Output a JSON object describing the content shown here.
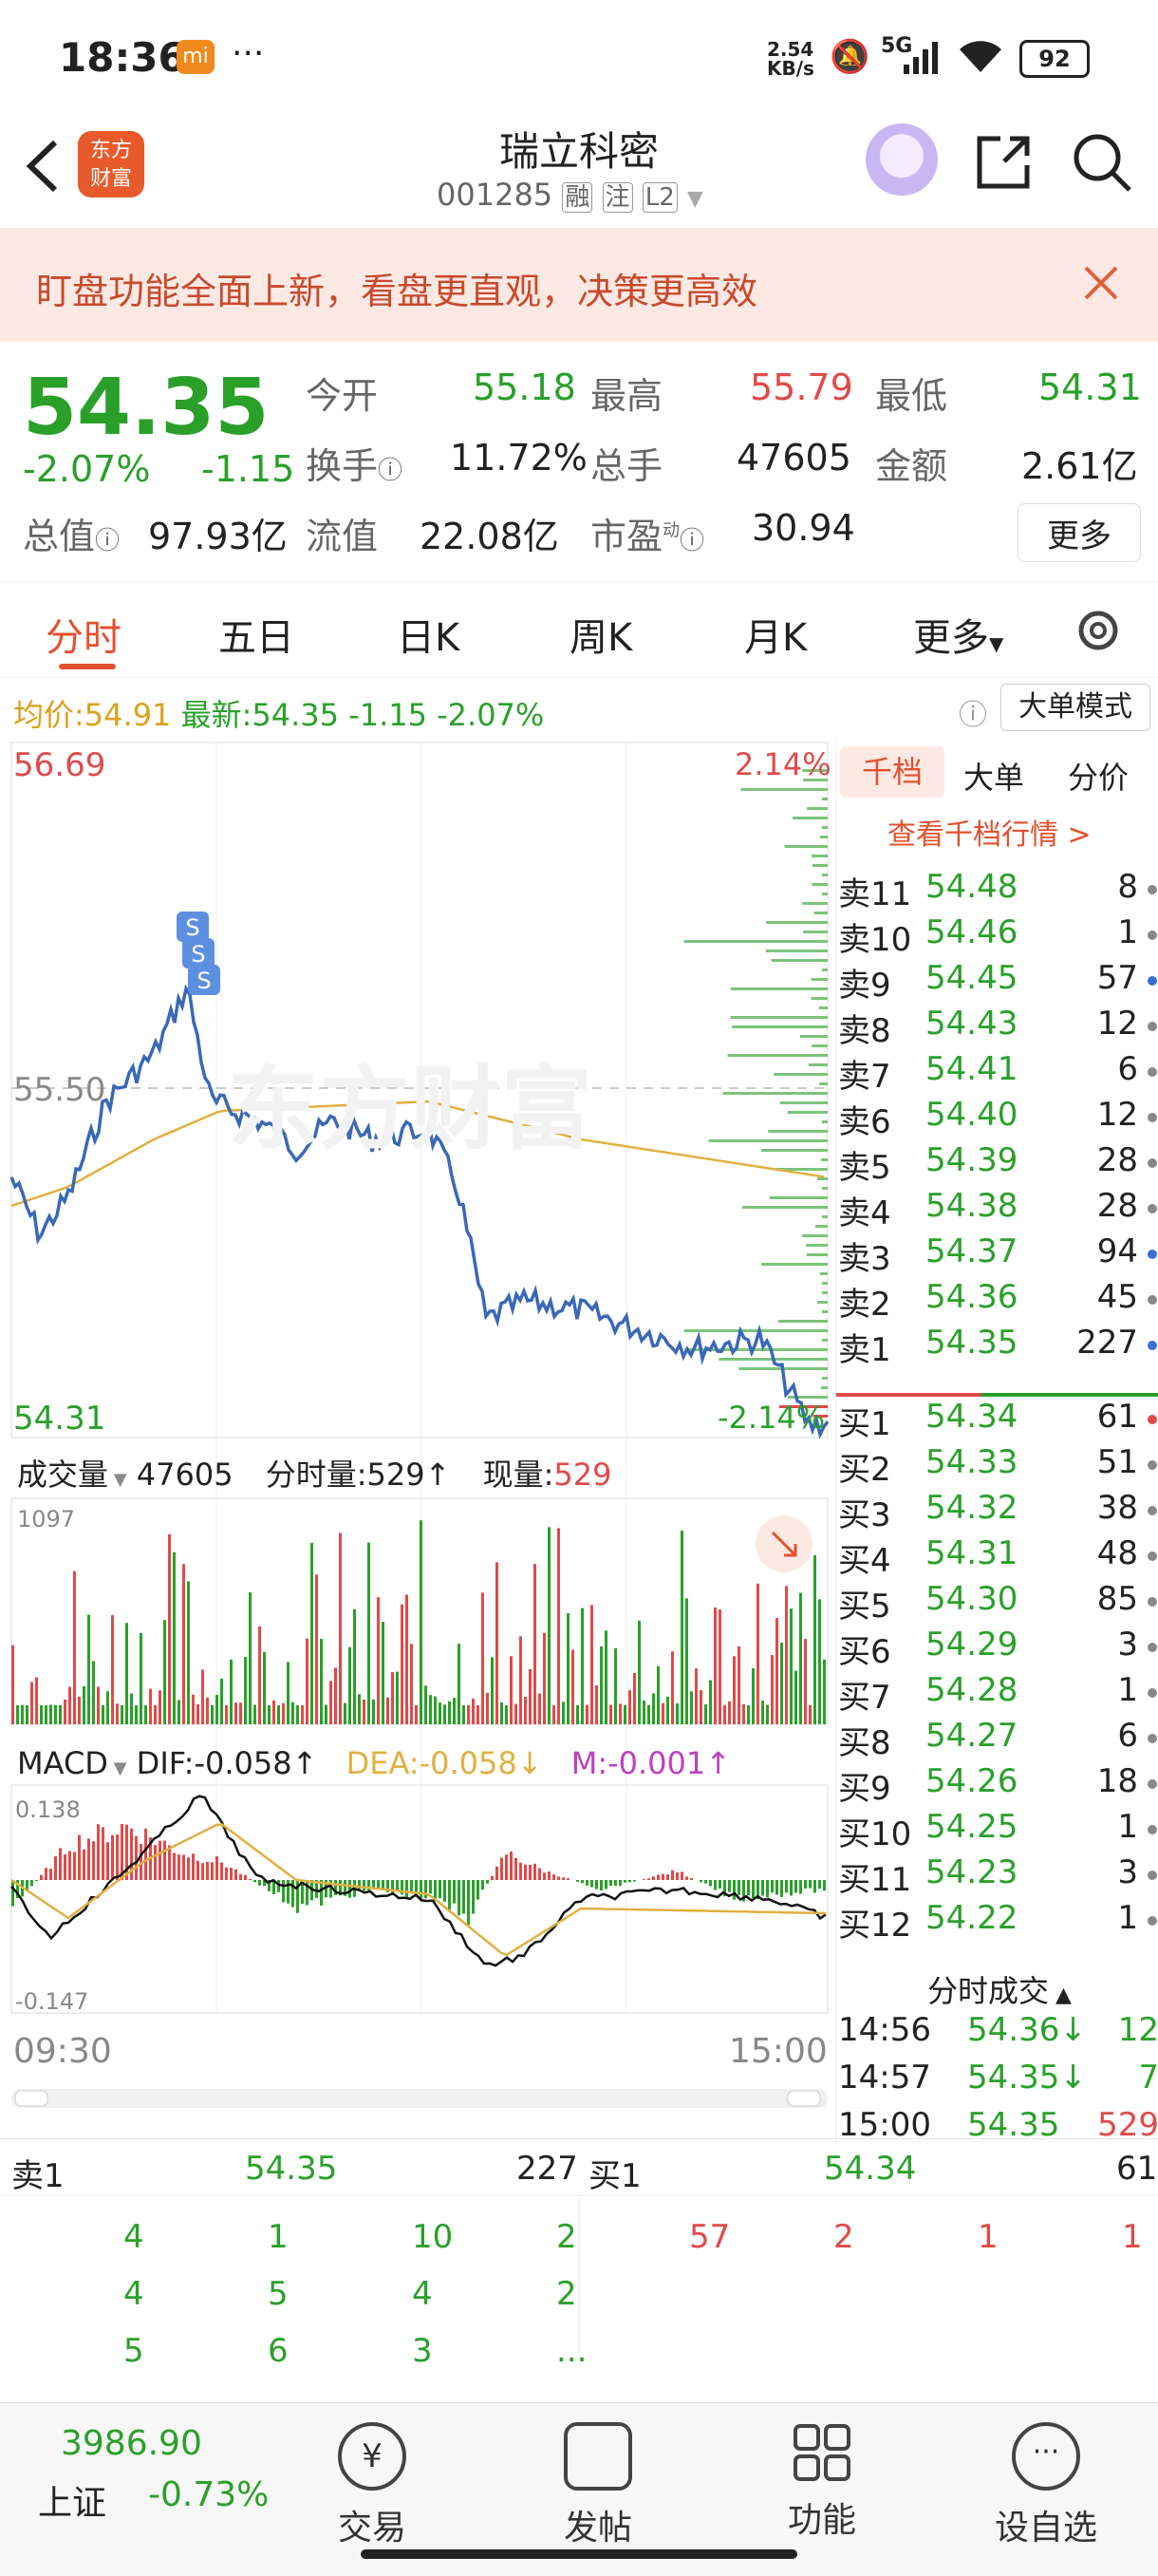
{
  "status": {
    "time": "18:36",
    "app_badge": "mi",
    "more": "···",
    "speed_top": "2.54",
    "speed_bottom": "KB/s",
    "network": "5G",
    "battery": "92"
  },
  "header": {
    "logo_top": "东方",
    "logo_bottom": "财富",
    "stock_name": "瑞立科密",
    "stock_code": "001285",
    "tags": [
      "融",
      "注",
      "L2"
    ]
  },
  "banner": {
    "text": "盯盘功能全面上新，看盘更直观，决策更高效"
  },
  "quote": {
    "price": "54.35",
    "change_pct": "-2.07%",
    "change": "-1.15",
    "open_label": "今开",
    "open": "55.18",
    "high_label": "最高",
    "high": "55.79",
    "low_label": "最低",
    "low": "54.31",
    "turnover_label": "换手",
    "turnover": "11.72%",
    "volume_label": "总手",
    "volume": "47605",
    "amount_label": "金额",
    "amount": "2.61亿",
    "mktcap_label": "总值",
    "mktcap": "97.93亿",
    "float_label": "流值",
    "float": "22.08亿",
    "pe_label": "市盈",
    "pe_sup": "动",
    "pe": "30.94",
    "more_btn": "更多"
  },
  "tabs": [
    "分时",
    "五日",
    "日K",
    "周K",
    "月K",
    "更多"
  ],
  "chart_info": {
    "avg_label": "均价:",
    "avg": "54.91",
    "last_label": "最新:",
    "last": "54.35",
    "chg": "-1.15",
    "chg_pct": "-2.07%",
    "big_order_mode": "大单模式",
    "price_top": "56.69",
    "price_mid": "55.50",
    "price_bottom": "54.31",
    "pct_top": "2.14%",
    "pct_bottom": "-2.14%",
    "watermark": "东方财富"
  },
  "volume_panel": {
    "label": "成交量",
    "total": "47605",
    "tick_label": "分时量:529",
    "now_label": "现量:",
    "now": "529",
    "max": "1097"
  },
  "macd_panel": {
    "label": "MACD",
    "dif": "DIF:-0.058",
    "dea": "DEA:-0.058",
    "m": "M:-0.001",
    "top": "0.138",
    "bottom": "-0.147"
  },
  "time_axis": {
    "start": "09:30",
    "end": "15:00"
  },
  "orderbook": {
    "tabs": [
      "千档",
      "大单",
      "分价"
    ],
    "link": "查看千档行情 >",
    "sells": [
      {
        "label": "卖11",
        "price": "54.48",
        "vol": "8",
        "dot": "#888888"
      },
      {
        "label": "卖10",
        "price": "54.46",
        "vol": "1",
        "dot": "#888888"
      },
      {
        "label": "卖9",
        "price": "54.45",
        "vol": "57",
        "dot": "#3a6fd8"
      },
      {
        "label": "卖8",
        "price": "54.43",
        "vol": "12",
        "dot": "#888888"
      },
      {
        "label": "卖7",
        "price": "54.41",
        "vol": "6",
        "dot": "#888888"
      },
      {
        "label": "卖6",
        "price": "54.40",
        "vol": "12",
        "dot": "#888888"
      },
      {
        "label": "卖5",
        "price": "54.39",
        "vol": "28",
        "dot": "#888888"
      },
      {
        "label": "卖4",
        "price": "54.38",
        "vol": "28",
        "dot": "#888888"
      },
      {
        "label": "卖3",
        "price": "54.37",
        "vol": "94",
        "dot": "#3a6fd8"
      },
      {
        "label": "卖2",
        "price": "54.36",
        "vol": "45",
        "dot": "#888888"
      },
      {
        "label": "卖1",
        "price": "54.35",
        "vol": "227",
        "dot": "#3a6fd8"
      }
    ],
    "buys": [
      {
        "label": "买1",
        "price": "54.34",
        "vol": "61",
        "dot": "#e04a4a"
      },
      {
        "label": "买2",
        "price": "54.33",
        "vol": "51",
        "dot": "#888888"
      },
      {
        "label": "买3",
        "price": "54.32",
        "vol": "38",
        "dot": "#888888"
      },
      {
        "label": "买4",
        "price": "54.31",
        "vol": "48",
        "dot": "#888888"
      },
      {
        "label": "买5",
        "price": "54.30",
        "vol": "85",
        "dot": "#888888"
      },
      {
        "label": "买6",
        "price": "54.29",
        "vol": "3",
        "dot": "#888888"
      },
      {
        "label": "买7",
        "price": "54.28",
        "vol": "1",
        "dot": "#888888"
      },
      {
        "label": "买8",
        "price": "54.27",
        "vol": "6",
        "dot": "#888888"
      },
      {
        "label": "买9",
        "price": "54.26",
        "vol": "18",
        "dot": "#888888"
      },
      {
        "label": "买10",
        "price": "54.25",
        "vol": "1",
        "dot": "#888888"
      },
      {
        "label": "买11",
        "price": "54.23",
        "vol": "3",
        "dot": "#888888"
      },
      {
        "label": "买12",
        "price": "54.22",
        "vol": "1",
        "dot": "#888888"
      }
    ],
    "ticks_title": "分时成交",
    "ticks": [
      {
        "time": "14:56",
        "price": "54.36↓",
        "vol": "12"
      },
      {
        "time": "14:57",
        "price": "54.35↓",
        "vol": "7"
      },
      {
        "time": "15:00",
        "price": "54.35",
        "vol": "529"
      }
    ]
  },
  "queue": {
    "sell_label": "卖1",
    "sell_price": "54.35",
    "sell_vol": "227",
    "buy_label": "买1",
    "buy_price": "54.34",
    "buy_vol": "61",
    "sell_rows": [
      [
        "4",
        "1",
        "10",
        "2"
      ],
      [
        "4",
        "5",
        "4",
        "2"
      ],
      [
        "5",
        "6",
        "3",
        "..."
      ]
    ],
    "buy_rows": [
      [
        "57",
        "2",
        "1",
        "1"
      ]
    ]
  },
  "bottom": {
    "index_value": "3986.90",
    "index_name": "上证",
    "index_chg": "-0.73%",
    "nav": [
      "交易",
      "发帖",
      "功能",
      "设自选"
    ]
  },
  "colors": {
    "up": "#e04a4a",
    "down": "#2aa02a",
    "price_line": "#3a68b8",
    "avg_line": "#e0b040",
    "banner_bg": "#fde9e4",
    "accent": "#e4502e"
  }
}
